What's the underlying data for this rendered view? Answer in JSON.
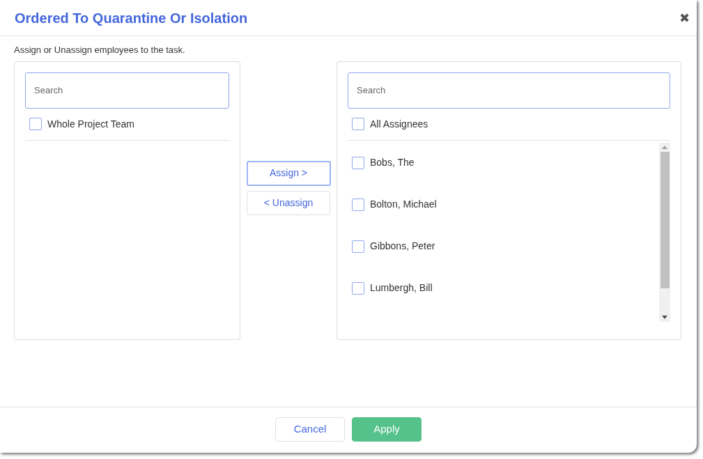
{
  "dialog": {
    "title": "Ordered To Quarantine Or Isolation",
    "close": "✖",
    "instructions": "Assign or Unassign employees to the task."
  },
  "left_panel": {
    "search": {
      "placeholder": "Search"
    },
    "select_all": {
      "label": "Whole Project Team",
      "checked": false
    }
  },
  "transfer_buttons": [
    {
      "label": "Assign >",
      "focused": true
    },
    {
      "label": "< Unassign",
      "focused": false
    }
  ],
  "right_panel": {
    "search": {
      "placeholder": "Search"
    },
    "select_all": {
      "label": "All Assignees",
      "checked": false
    },
    "items": [
      {
        "label": "Bobs, The",
        "checked": false
      },
      {
        "label": "Bolton, Michael",
        "checked": false
      },
      {
        "label": "Gibbons, Peter",
        "checked": false
      },
      {
        "label": "Lumbergh, Bill",
        "checked": false
      }
    ]
  },
  "footer": {
    "buttons": [
      {
        "label": "Cancel",
        "kind": "secondary"
      },
      {
        "label": "Apply",
        "kind": "primary"
      }
    ]
  }
}
